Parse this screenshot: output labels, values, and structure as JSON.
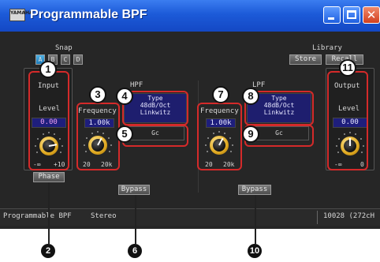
{
  "window": {
    "title": "Programmable BPF",
    "logo_text": "YAMAHA",
    "controls": [
      "minimize",
      "maximize",
      "close"
    ]
  },
  "snap": {
    "label": "Snap",
    "buttons": [
      "A",
      "B",
      "C",
      "D"
    ],
    "active": "A"
  },
  "library": {
    "label": "Library",
    "store": "Store",
    "recall": "Recall"
  },
  "input": {
    "title": "Input",
    "level_label": "Level",
    "level_value": "0.00",
    "min_label": "-∞",
    "max_label": "+10",
    "phase_label": "Phase"
  },
  "hpf": {
    "title": "HPF",
    "freq_label": "Frequency",
    "freq_value": "1.00k",
    "min_label": "20",
    "max_label": "20k",
    "type_label": "Type",
    "type_slope": "48dB/Oct",
    "type_name": "Linkwitz",
    "gc_label": "Gc",
    "bypass_label": "Bypass"
  },
  "lpf": {
    "title": "LPF",
    "freq_label": "Frequency",
    "freq_value": "1.00k",
    "min_label": "20",
    "max_label": "20k",
    "type_label": "Type",
    "type_slope": "48dB/Oct",
    "type_name": "Linkwitz",
    "gc_label": "Gc",
    "bypass_label": "Bypass"
  },
  "output": {
    "title": "Output",
    "level_label": "Level",
    "level_value": "0.00",
    "min_label": "-∞",
    "max_label": "0"
  },
  "status": {
    "name": "Programmable BPF",
    "mode": "Stereo",
    "info": "10028 (272cH"
  },
  "callouts": {
    "c1": "1",
    "c2": "2",
    "c3": "3",
    "c4": "4",
    "c5": "5",
    "c6": "6",
    "c7": "7",
    "c8": "8",
    "c9": "9",
    "c10": "10",
    "c11": "11"
  },
  "colors": {
    "titlebar": "#1c5ad8",
    "panel_bg": "#262626",
    "readout_bg": "#1e1e7c",
    "knob_gold": "#e0a920",
    "callout_red": "#d42a2a"
  }
}
